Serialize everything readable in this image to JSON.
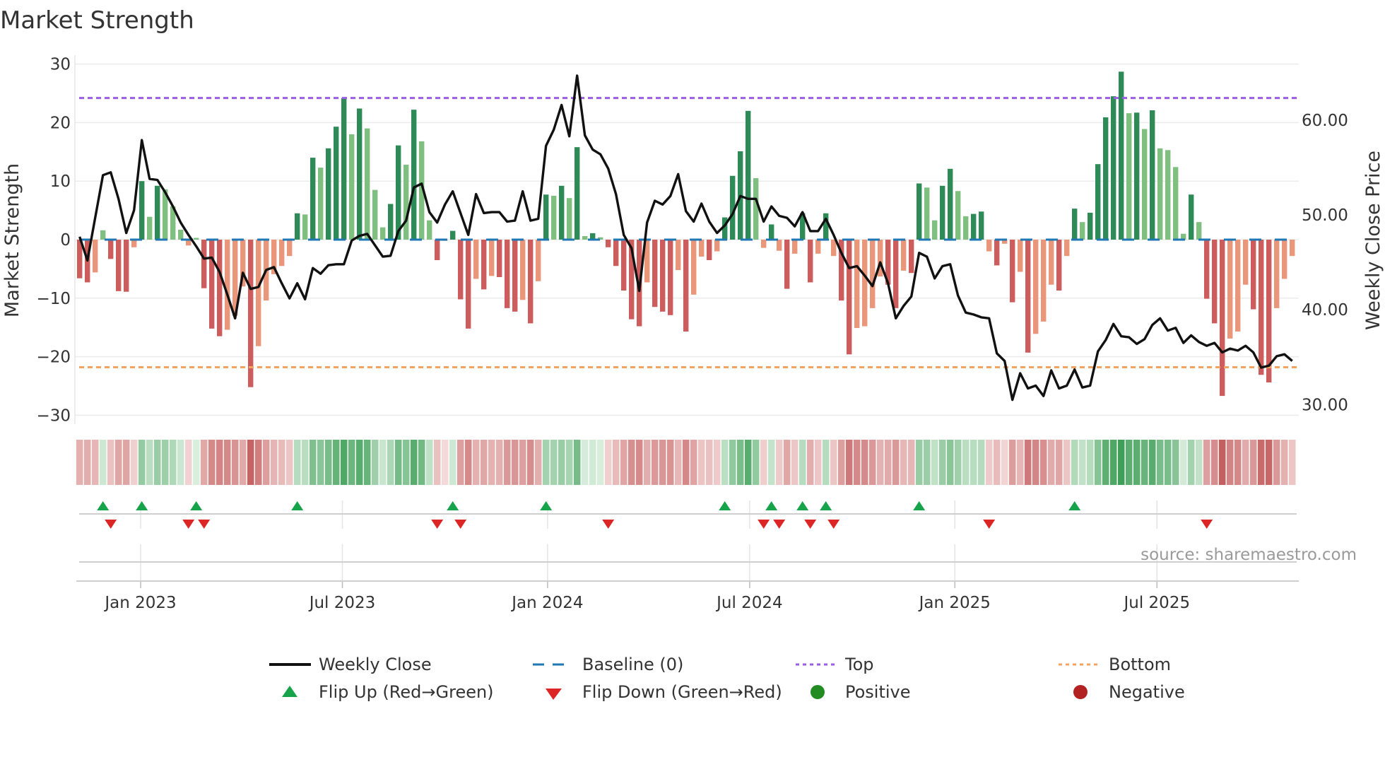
{
  "title": "Market Strength",
  "source": "source: sharemaestro.com",
  "colors": {
    "pos_strong": "#2e8b57",
    "pos_weak": "#7fbf7f",
    "neg_strong": "#cd5c5c",
    "neg_weak": "#e9967a",
    "baseline": "#1f77b4",
    "top": "#9b5de5",
    "bottom": "#f4a460",
    "close": "#111111",
    "flip_up": "#16a34a",
    "flip_down": "#dc2626",
    "positive": "#228b22",
    "negative": "#b22222"
  },
  "legend": {
    "weekly_close": "Weekly Close",
    "baseline": "Baseline (0)",
    "top": "Top",
    "bottom": "Bottom",
    "flip_up": "Flip Up (Red→Green)",
    "flip_down": "Flip Down (Green→Red)",
    "positive": "Positive",
    "negative": "Negative"
  },
  "chart_data": {
    "type": "bar",
    "title": "Market Strength",
    "ylabel": "Market Strength",
    "y2label": "Weekly Close Price",
    "ylim": [
      -30,
      30
    ],
    "y2lim": [
      30,
      60
    ],
    "y_ticks": [
      30,
      20,
      10,
      0,
      -10,
      -20,
      -30
    ],
    "y_tick_labels": [
      "30",
      "20",
      "10",
      "0",
      "−10",
      "−20",
      "−30"
    ],
    "y2_ticks": [
      60,
      50,
      40,
      30
    ],
    "y2_tick_labels": [
      "60.00",
      "50.00",
      "40.00",
      "30.00"
    ],
    "x_unit": "week index",
    "x_ticks": [
      7.85,
      33.8,
      60.2,
      86.2,
      112.6,
      138.6
    ],
    "x_tick_labels": [
      "Jan 2023",
      "Jul 2023",
      "Jan 2024",
      "Jul 2024",
      "Jan 2025",
      "Jul 2025"
    ],
    "top_level": 24.2,
    "bottom_level": -21.8,
    "baseline_level": 0,
    "strength": [
      -6.6,
      -7.3,
      -5.6,
      1.6,
      -3.3,
      -8.8,
      -8.9,
      -1.3,
      10,
      3.9,
      9.2,
      8.6,
      5.7,
      1.7,
      -1.0,
      0.3,
      -8.3,
      -15.2,
      -16.5,
      -15.4,
      -13,
      -8,
      -25.2,
      -18.2,
      -10.4,
      -5.9,
      -4.5,
      -2.8,
      4.5,
      4.3,
      14,
      12.3,
      15.6,
      19.3,
      24.2,
      18,
      22.4,
      19,
      8.5,
      2.1,
      6.1,
      16.1,
      12.8,
      22.2,
      16.8,
      3.3,
      -3.5,
      -0.2,
      1.5,
      -10.2,
      -15.2,
      -6.7,
      -8.5,
      -6.2,
      -6.4,
      -11.7,
      -12.3,
      -10.3,
      -14.3,
      -7.1,
      7.7,
      7.5,
      9.2,
      7.1,
      15.8,
      0.6,
      1.1,
      0.4,
      -1.3,
      -4.5,
      -8.7,
      -13.6,
      -14.8,
      -7.3,
      -11.5,
      -12.3,
      -12.9,
      -5.2,
      -15.7,
      -9.4,
      -2.9,
      -3.5,
      -2.0,
      3.8,
      10.9,
      15.1,
      22,
      10.5,
      -1.4,
      2.6,
      -1.9,
      -8.4,
      -2.4,
      4.5,
      -7.3,
      -2.4,
      4.5,
      -2.8,
      -10.4,
      -19.6,
      -15.1,
      -14.8,
      -11.7,
      -6.3,
      -7.7,
      -11.7,
      -5.3,
      -5.7,
      9.6,
      8.9,
      3.3,
      9.2,
      12.1,
      8.3,
      4.0,
      4.4,
      4.8,
      -2.0,
      -4.4,
      -0.7,
      -10.7,
      -5.5,
      -19.3,
      -16.1,
      -14.0,
      -7.7,
      -8.7,
      -2.8,
      5.3,
      3.0,
      4.6,
      12.9,
      20.9,
      24.5,
      28.7,
      21.6,
      21.7,
      18.9,
      22.1,
      15.6,
      15.3,
      12.4,
      1.0,
      7.7,
      3.0,
      -10.1,
      -14.3,
      -26.7,
      -16.9,
      -15.7,
      -7.7,
      -11.9,
      -23.1,
      -24.4,
      -11.7,
      -6.7,
      -2.8
    ],
    "weekly_close": [
      47.7,
      45.2,
      49.7,
      54.2,
      54.5,
      51.7,
      48.1,
      50.5,
      57.9,
      53.8,
      53.7,
      52.4,
      50.9,
      49.2,
      47.9,
      46.7,
      45.4,
      45.5,
      44.0,
      41.6,
      39.1,
      43.9,
      42.2,
      42.4,
      44.2,
      44.5,
      42.8,
      41.2,
      42.8,
      41.1,
      44.4,
      43.8,
      44.7,
      44.8,
      44.8,
      47.3,
      47.8,
      48.0,
      46.8,
      45.6,
      45.7,
      48.3,
      49.4,
      52.9,
      53.3,
      50.3,
      49.2,
      51.1,
      52.5,
      50.2,
      47.9,
      52.2,
      50.2,
      50.3,
      50.3,
      49.3,
      49.4,
      52.5,
      49.4,
      49.6,
      57.3,
      59.0,
      61.6,
      58.3,
      64.7,
      58.4,
      56.9,
      56.4,
      54.9,
      52.2,
      47.9,
      46.5,
      42.0,
      49.2,
      51.5,
      51.1,
      52.0,
      54.3,
      50.4,
      49.3,
      51.2,
      49.3,
      48.1,
      48.9,
      50.1,
      52.0,
      51.7,
      51.7,
      49.3,
      50.9,
      49.9,
      49.7,
      48.8,
      50.3,
      48.3,
      48.3,
      49.6,
      47.9,
      46.0,
      44.4,
      44.6,
      43.6,
      42.5,
      45.0,
      42.8,
      39.1,
      40.4,
      41.4,
      46.0,
      45.6,
      43.3,
      44.6,
      44.8,
      41.5,
      39.7,
      39.5,
      39.2,
      39.1,
      35.4,
      34.6,
      30.5,
      33.3,
      31.7,
      32.0,
      30.9,
      33.6,
      31.7,
      32.0,
      33.7,
      31.8,
      32.0,
      35.6,
      36.8,
      38.5,
      37.2,
      37.1,
      36.4,
      36.9,
      38.4,
      39.1,
      37.8,
      38.1,
      36.5,
      37.3,
      36.6,
      36.2,
      36.5,
      35.5,
      35.9,
      35.7,
      36.2,
      35.5,
      33.9,
      34.1,
      35.1,
      35.3,
      34.6
    ],
    "legend_placement": "bottom"
  }
}
